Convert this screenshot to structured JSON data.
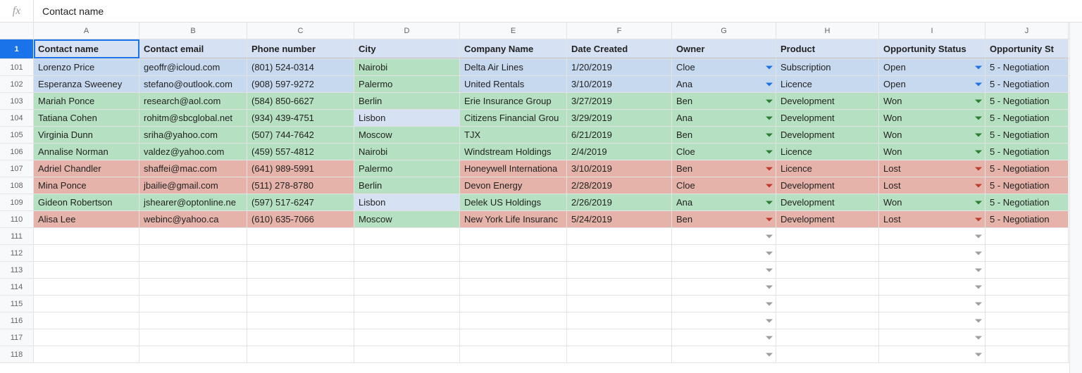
{
  "formulaBar": {
    "value": "Contact name"
  },
  "columns": [
    {
      "letter": "A",
      "label": "Contact name"
    },
    {
      "letter": "B",
      "label": "Contact email"
    },
    {
      "letter": "C",
      "label": "Phone number"
    },
    {
      "letter": "D",
      "label": "City"
    },
    {
      "letter": "E",
      "label": "Company Name"
    },
    {
      "letter": "F",
      "label": "Date Created"
    },
    {
      "letter": "G",
      "label": "Owner"
    },
    {
      "letter": "H",
      "label": "Product"
    },
    {
      "letter": "I",
      "label": "Opportunity Status"
    },
    {
      "letter": "J",
      "label": "Opportunity St"
    }
  ],
  "headerRowNumber": "1",
  "rows": [
    {
      "n": "101",
      "status": "open",
      "city_bg": "green",
      "c": [
        "Lorenzo Price",
        "geoffr@icloud.com",
        "(801) 524-0314",
        "Nairobi",
        "Delta Air Lines",
        "1/20/2019",
        "Cloe",
        "Subscription",
        "Open",
        "5 - Negotiation"
      ]
    },
    {
      "n": "102",
      "status": "open",
      "city_bg": "green",
      "c": [
        "Esperanza Sweeney",
        "stefano@outlook.com",
        "(908) 597-9272",
        "Palermo",
        "United Rentals",
        "3/10/2019",
        "Ana",
        "Licence",
        "Open",
        "5 - Negotiation"
      ]
    },
    {
      "n": "103",
      "status": "won",
      "city_bg": "green",
      "c": [
        "Mariah Ponce",
        "research@aol.com",
        "(584) 850-6627",
        "Berlin",
        "Erie Insurance Group",
        "3/27/2019",
        "Ben",
        "Development",
        "Won",
        "5 - Negotiation"
      ]
    },
    {
      "n": "104",
      "status": "won",
      "city_bg": "ltblue",
      "c": [
        "Tatiana Cohen",
        "rohitm@sbcglobal.net",
        "(934) 439-4751",
        "Lisbon",
        "Citizens Financial Grou",
        "3/29/2019",
        "Ana",
        "Development",
        "Won",
        "5 - Negotiation"
      ]
    },
    {
      "n": "105",
      "status": "won",
      "city_bg": "green",
      "c": [
        "Virginia Dunn",
        "sriha@yahoo.com",
        "(507) 744-7642",
        "Moscow",
        "TJX",
        "6/21/2019",
        "Ben",
        "Development",
        "Won",
        "5 - Negotiation"
      ]
    },
    {
      "n": "106",
      "status": "won",
      "city_bg": "green",
      "c": [
        "Annalise Norman",
        "valdez@yahoo.com",
        "(459) 557-4812",
        "Nairobi",
        "Windstream Holdings",
        "2/4/2019",
        "Cloe",
        "Licence",
        "Won",
        "5 - Negotiation"
      ]
    },
    {
      "n": "107",
      "status": "lost",
      "city_bg": "green",
      "c": [
        "Adriel Chandler",
        "shaffei@mac.com",
        "(641) 989-5991",
        "Palermo",
        "Honeywell Internationa",
        "3/10/2019",
        "Ben",
        "Licence",
        "Lost",
        "5 - Negotiation"
      ]
    },
    {
      "n": "108",
      "status": "lost",
      "city_bg": "green",
      "c": [
        "Mina Ponce",
        "jbailie@gmail.com",
        "(511) 278-8780",
        "Berlin",
        "Devon Energy",
        "2/28/2019",
        "Cloe",
        "Development",
        "Lost",
        "5 - Negotiation"
      ]
    },
    {
      "n": "109",
      "status": "won",
      "city_bg": "ltblue",
      "c": [
        "Gideon Robertson",
        "jshearer@optonline.ne",
        "(597) 517-6247",
        "Lisbon",
        "Delek US Holdings",
        "2/26/2019",
        "Ana",
        "Development",
        "Won",
        "5 - Negotiation"
      ]
    },
    {
      "n": "110",
      "status": "lost",
      "city_bg": "green",
      "c": [
        "Alisa Lee",
        "webinc@yahoo.ca",
        "(610) 635-7066",
        "Moscow",
        "New York Life Insuranc",
        "5/24/2019",
        "Ben",
        "Development",
        "Lost",
        "5 - Negotiation"
      ]
    }
  ],
  "emptyRows": [
    "111",
    "112",
    "113",
    "114",
    "115",
    "116",
    "117",
    "118"
  ]
}
